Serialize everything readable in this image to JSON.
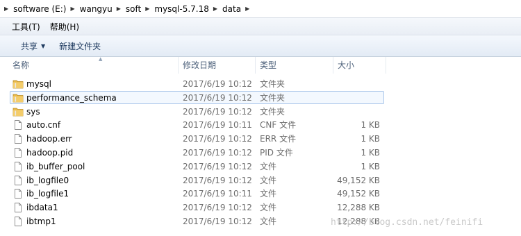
{
  "breadcrumb": [
    "software (E:)",
    "wangyu",
    "soft",
    "mysql-5.7.18",
    "data"
  ],
  "menu": {
    "tools": "工具(T)",
    "help": "帮助(H)"
  },
  "toolbar": {
    "share": "共享",
    "new_folder": "新建文件夹"
  },
  "columns": {
    "name": "名称",
    "date": "修改日期",
    "type": "类型",
    "size": "大小"
  },
  "files": [
    {
      "name": "mysql",
      "date": "2017/6/19 10:12",
      "type": "文件夹",
      "size": "",
      "icon": "folder-icon"
    },
    {
      "name": "performance_schema",
      "date": "2017/6/19 10:12",
      "type": "文件夹",
      "size": "",
      "icon": "folder-icon"
    },
    {
      "name": "sys",
      "date": "2017/6/19 10:12",
      "type": "文件夹",
      "size": "",
      "icon": "folder-icon"
    },
    {
      "name": "auto.cnf",
      "date": "2017/6/19 10:11",
      "type": "CNF 文件",
      "size": "1 KB",
      "icon": "file-icon"
    },
    {
      "name": "hadoop.err",
      "date": "2017/6/19 10:12",
      "type": "ERR 文件",
      "size": "1 KB",
      "icon": "file-icon"
    },
    {
      "name": "hadoop.pid",
      "date": "2017/6/19 10:12",
      "type": "PID 文件",
      "size": "1 KB",
      "icon": "file-icon"
    },
    {
      "name": "ib_buffer_pool",
      "date": "2017/6/19 10:12",
      "type": "文件",
      "size": "1 KB",
      "icon": "file-icon"
    },
    {
      "name": "ib_logfile0",
      "date": "2017/6/19 10:12",
      "type": "文件",
      "size": "49,152 KB",
      "icon": "file-icon"
    },
    {
      "name": "ib_logfile1",
      "date": "2017/6/19 10:11",
      "type": "文件",
      "size": "49,152 KB",
      "icon": "file-icon"
    },
    {
      "name": "ibdata1",
      "date": "2017/6/19 10:12",
      "type": "文件",
      "size": "12,288 KB",
      "icon": "file-icon"
    },
    {
      "name": "ibtmp1",
      "date": "2017/6/19 10:12",
      "type": "文件",
      "size": "12,288 KB",
      "icon": "file-icon"
    }
  ],
  "selected_row": 1,
  "watermark": "http://blog.csdn.net/feinifi",
  "colors": {
    "folder": "#e8b84a",
    "hover_border": "#a9c6ea",
    "header_text": "#4c607a"
  }
}
